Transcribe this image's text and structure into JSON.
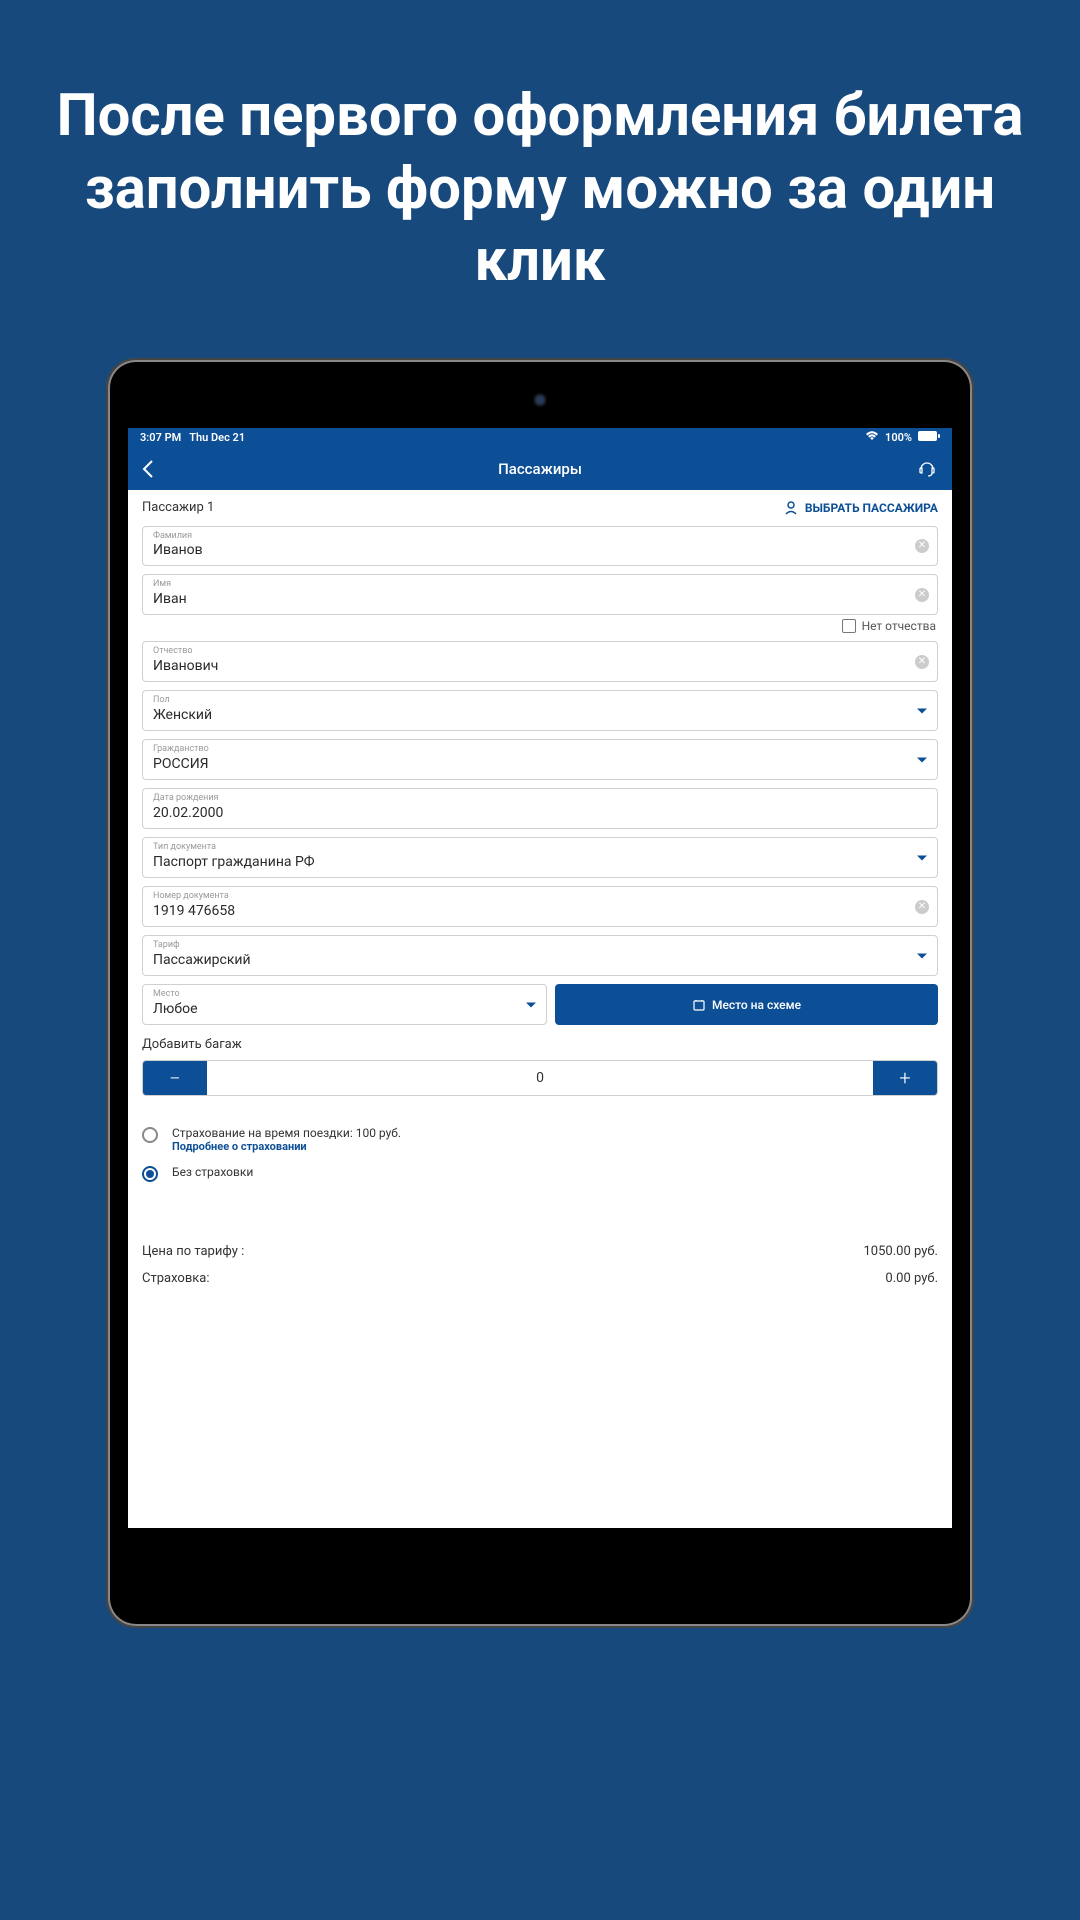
{
  "promo": "После первого оформления билета заполнить форму можно за один клик",
  "statusbar": {
    "time": "3:07 PM",
    "date": "Thu Dec 21",
    "battery": "100%"
  },
  "navbar": {
    "title": "Пассажиры"
  },
  "section": {
    "title": "Пассажир 1",
    "select_label": "ВЫБРАТЬ ПАССАЖИРА"
  },
  "fields": {
    "surname": {
      "label": "Фамилия",
      "value": "Иванов"
    },
    "name": {
      "label": "Имя",
      "value": "Иван"
    },
    "no_patronymic": "Нет отчества",
    "patronymic": {
      "label": "Отчество",
      "value": "Иванович"
    },
    "gender": {
      "label": "Пол",
      "value": "Женский"
    },
    "citizenship": {
      "label": "Гражданство",
      "value": "РОССИЯ"
    },
    "birthdate": {
      "label": "Дата рождения",
      "value": "20.02.2000"
    },
    "doctype": {
      "label": "Тип документа",
      "value": "Паспорт гражданина РФ"
    },
    "docnum": {
      "label": "Номер документа",
      "value": "1919 476658"
    },
    "tariff": {
      "label": "Тариф",
      "value": "Пассажирский"
    },
    "seat": {
      "label": "Место",
      "value": "Любое"
    },
    "seat_button": "Место на схеме"
  },
  "luggage": {
    "label": "Добавить багаж",
    "count": "0"
  },
  "insurance": {
    "option_with": "Страхование на время поездки: 100 руб.",
    "link": "Подробнее о страховании",
    "option_without": "Без страховки"
  },
  "prices": {
    "tariff_label": "Цена по тарифу :",
    "tariff_value": "1050.00 руб.",
    "insurance_label": "Страховка:",
    "insurance_value": "0.00 руб."
  }
}
